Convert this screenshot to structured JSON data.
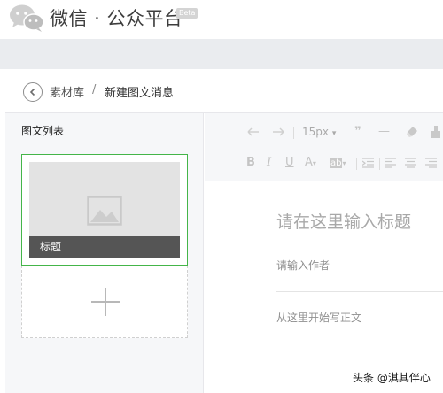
{
  "header": {
    "brand": "微信 · 公众平台",
    "beta_badge": "Beta",
    "logo_icon": "wechat-logo-icon"
  },
  "breadcrumb": {
    "back_icon": "chevron-left-icon",
    "parent": "素材库",
    "separator": "/",
    "current": "新建图文消息"
  },
  "article_list": {
    "title": "图文列表",
    "cards": [
      {
        "caption": "标题",
        "thumbnail_icon": "image-placeholder-icon",
        "selected": true
      }
    ],
    "add_icon": "plus-icon"
  },
  "toolbar": {
    "font_size": "15px",
    "row1_icons": [
      "undo-icon",
      "redo-icon",
      "font-size-dropdown",
      "blockquote-icon",
      "horizontal-rule-icon",
      "clear-format-icon",
      "paint-format-icon"
    ],
    "row2_icons": [
      "bold-icon",
      "italic-icon",
      "underline-icon",
      "font-color-icon",
      "background-color-icon",
      "indent-icon",
      "align-left-icon",
      "align-center-icon",
      "align-right-icon"
    ],
    "labels": {
      "bold": "B",
      "italic": "I",
      "underline": "U",
      "font_color": "A",
      "bg_color": "ab",
      "dropdown_caret": "▾",
      "quote": "❞",
      "rule": "—"
    }
  },
  "editor": {
    "title_placeholder": "请在这里输入标题",
    "author_placeholder": "请输入作者",
    "body_placeholder": "从这里开始写正文"
  },
  "watermark": "头条 @淇其伴心",
  "colors": {
    "accent_green": "#44b549",
    "caption_bg": "#555555",
    "header_band": "#eaecef"
  }
}
